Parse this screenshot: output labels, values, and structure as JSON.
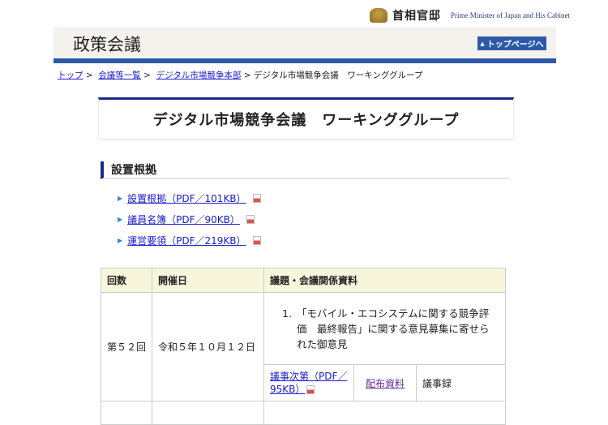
{
  "header": {
    "logo_jp": "首相官邸",
    "logo_en": "Prime Minister of Japan and His Cabinet",
    "section": "政策会議",
    "top_button": "トップページへ"
  },
  "breadcrumb": [
    {
      "label": "トップ",
      "link": true
    },
    {
      "label": "会議等一覧",
      "link": true
    },
    {
      "label": "デジタル市場競争本部",
      "link": true
    },
    {
      "label": "デジタル市場競争会議　ワーキンググループ",
      "link": false
    }
  ],
  "title": "デジタル市場競争会議　ワーキンググループ",
  "section_heading": "設置根拠",
  "links": [
    "設置根拠（PDF／101KB）",
    "議員名簿（PDF／90KB）",
    "運営要領（PDF／219KB）"
  ],
  "table": {
    "headers": [
      "回数",
      "開催日",
      "議題・会議関係資料"
    ],
    "rows": [
      {
        "round": "第５２回",
        "date": "令和５年１０月１２日",
        "agenda": "「モバイル・エコシステムに関する競争評価　最終報告」に関する意見募集に寄せられた御意見",
        "agenda_no": "1.",
        "docs": [
          "議事次第（PDF／95KB）",
          "配布資料",
          "議事録"
        ]
      }
    ]
  }
}
